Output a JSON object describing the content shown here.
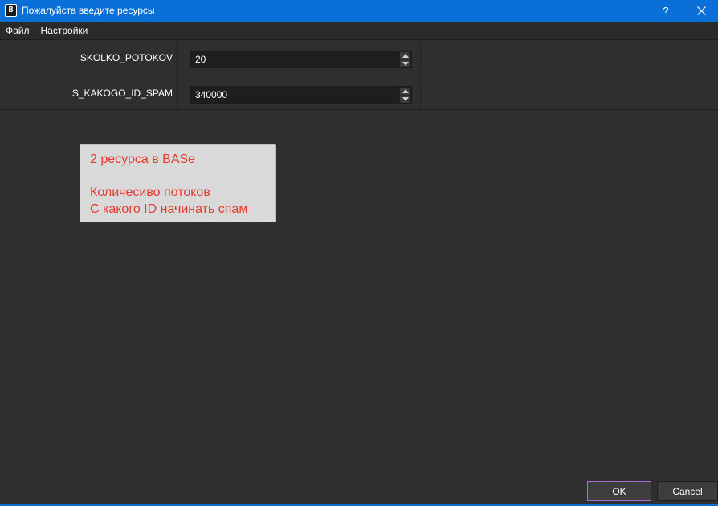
{
  "window": {
    "title": "Пожалуйста введите ресурсы",
    "app_icon_letter": "B",
    "help_label": "?",
    "accent_color": "#0a6fd6"
  },
  "menu": {
    "items": [
      {
        "label": "Файл"
      },
      {
        "label": "Настройки"
      }
    ]
  },
  "form": {
    "rows": [
      {
        "label": "SKOLKO_POTOKOV",
        "value": "20"
      },
      {
        "label": "S_KAKOGO_ID_SPAM",
        "value": "340000"
      }
    ]
  },
  "note": {
    "line1": "2 ресурса в BASe",
    "line2": "Количесиво потоков",
    "line3": "С какого ID начинать спам",
    "text_color": "#e53a2f"
  },
  "buttons": {
    "ok_label": "OK",
    "cancel_label": "Cancel"
  }
}
